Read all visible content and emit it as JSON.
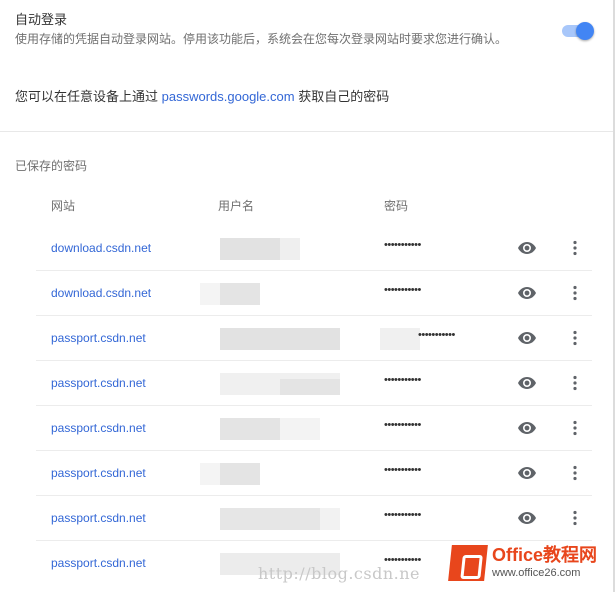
{
  "autologin": {
    "title": "自动登录",
    "description": "使用存储的凭据自动登录网站。停用该功能后，系统会在您每次登录网站时要求您进行确认。",
    "enabled": true
  },
  "hint": {
    "prefix": "您可以在任意设备上通过 ",
    "link": "passwords.google.com",
    "suffix": " 获取自己的密码"
  },
  "saved": {
    "title": "已保存的密码",
    "headers": {
      "site": "网站",
      "username": "用户名",
      "password": "密码"
    },
    "rows": [
      {
        "site": "download.csdn.net",
        "password": "•••••••••••"
      },
      {
        "site": "download.csdn.net",
        "password": "•••••••••••"
      },
      {
        "site": "passport.csdn.net",
        "password": "•••••••••••"
      },
      {
        "site": "passport.csdn.net",
        "password": "•••••••••••"
      },
      {
        "site": "passport.csdn.net",
        "password": "•••••••••••"
      },
      {
        "site": "passport.csdn.net",
        "password": "•••••••••••"
      },
      {
        "site": "passport.csdn.net",
        "password": "•••••••••••"
      },
      {
        "site": "passport.csdn.net",
        "password": "•••••••••••"
      }
    ]
  },
  "icons": {
    "eye": "eye-icon",
    "more": "more-vertical-icon"
  },
  "colors": {
    "accent": "#4285f4",
    "link": "#3367d6",
    "logo": "#e8461c"
  },
  "watermark": {
    "url": "http://blog.csdn.ne",
    "logo_brand_a": "Office",
    "logo_brand_b": "教程网",
    "logo_url": "www.office26.com"
  }
}
